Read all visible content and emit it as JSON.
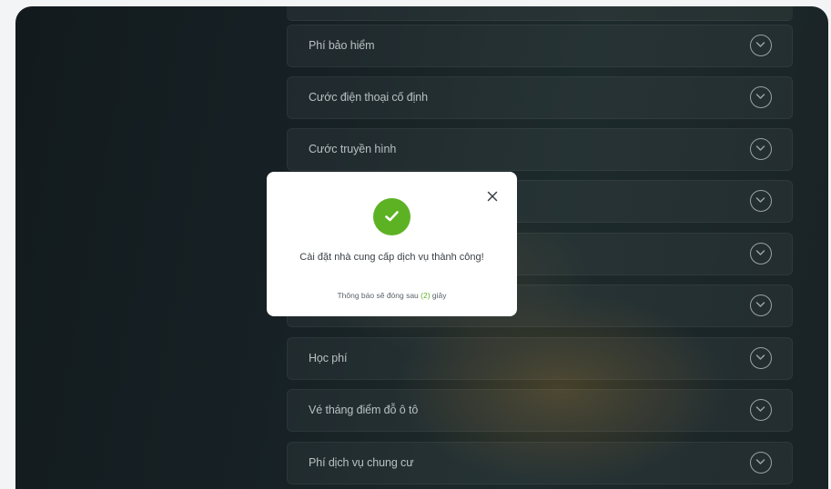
{
  "list": {
    "items": [
      {
        "label": "Phí bảo hiểm"
      },
      {
        "label": "Cước điện thoại cố định"
      },
      {
        "label": "Cước truyền hình"
      },
      {
        "label": ""
      },
      {
        "label": ""
      },
      {
        "label": ""
      },
      {
        "label": "Học phí"
      },
      {
        "label": "Vé tháng điểm đỗ ô tô"
      },
      {
        "label": "Phí dịch vụ chung cư"
      }
    ]
  },
  "modal": {
    "message": "Cài đặt nhà cung cấp dịch vụ thành công!",
    "note_prefix": "Thông báo sẽ đóng sau ",
    "countdown": "(2)",
    "note_suffix": " giây",
    "success_color": "#5db224",
    "icons": {
      "close": "close-icon",
      "success": "check-circle-icon"
    }
  },
  "icons": {
    "row_action": "chevron-down-circle-icon"
  }
}
